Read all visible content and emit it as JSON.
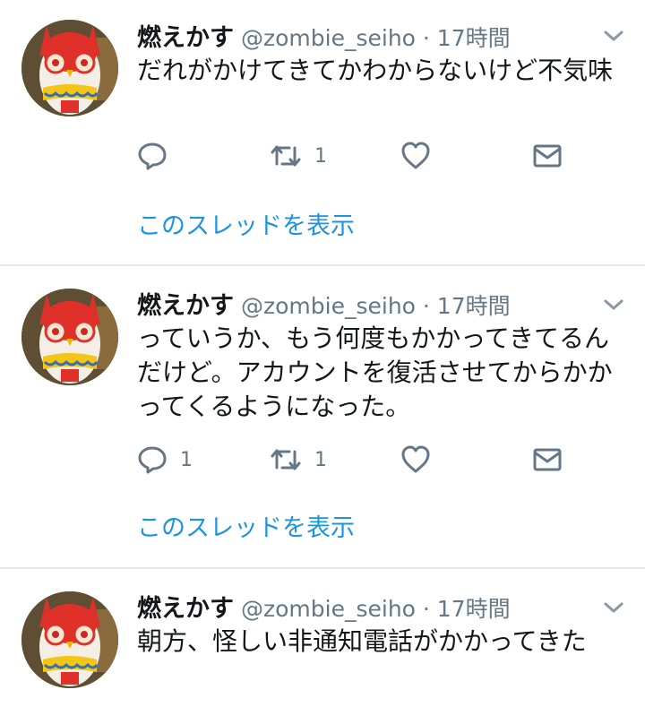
{
  "tweets": [
    {
      "name": "燃えかす",
      "meta": "@zombie_seiho · 17時間",
      "text": "だれがかけてきてかわからないけど不気味",
      "reply_count": "",
      "retweet_count": "1",
      "show_thread": "このスレッドを表示"
    },
    {
      "name": "燃えかす",
      "meta": "@zombie_seiho · 17時間",
      "text": "っていうか、もう何度もかかってきてるんだけど。アカウントを復活させてからかかってくるようになった。",
      "reply_count": "1",
      "retweet_count": "1",
      "show_thread": "このスレッドを表示"
    },
    {
      "name": "燃えかす",
      "meta": "@zombie_seiho · 17時間",
      "text": "朝方、怪しい非通知電話がかかってきた"
    }
  ],
  "icons": {
    "reply": "reply-icon",
    "retweet": "retweet-icon",
    "like": "heart-icon",
    "dm": "envelope-icon",
    "menu": "chevron-down-icon"
  },
  "colors": {
    "link": "#1b95e0",
    "muted": "#657786",
    "divider": "#e1e8ed"
  }
}
